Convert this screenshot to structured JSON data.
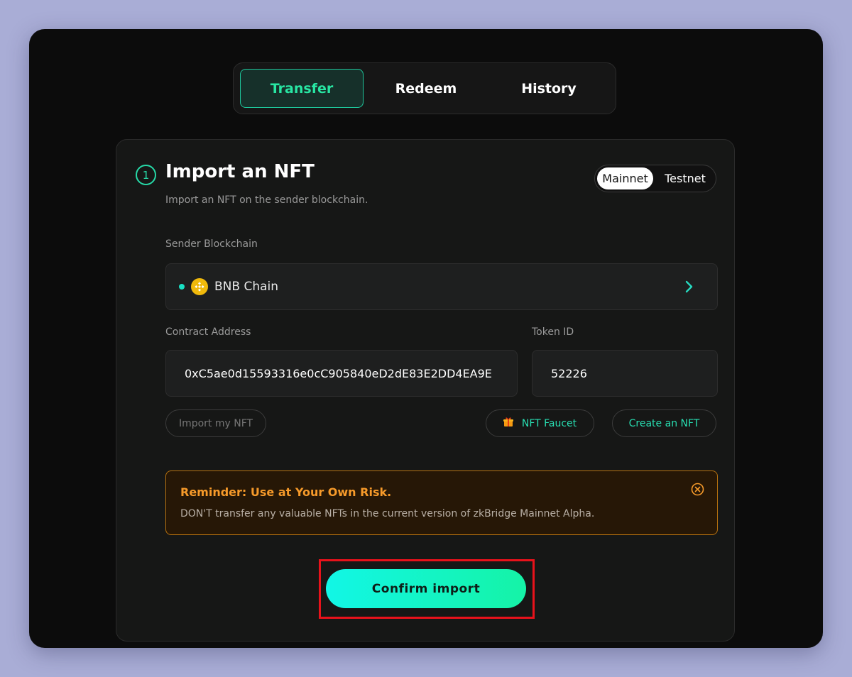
{
  "tabs": [
    {
      "label": "Transfer",
      "active": true
    },
    {
      "label": "Redeem",
      "active": false
    },
    {
      "label": "History",
      "active": false
    }
  ],
  "step": {
    "number": "1",
    "title": "Import an NFT",
    "subtitle": "Import an NFT on the sender blockchain."
  },
  "network": {
    "options": [
      "Mainnet",
      "Testnet"
    ],
    "selected": "Mainnet"
  },
  "sender": {
    "label": "Sender Blockchain",
    "chain_name": "BNB Chain",
    "chain_icon": "bnb-icon"
  },
  "contract": {
    "label": "Contract Address",
    "value": "0xC5ae0d15593316e0cC905840eD2dE83E2DD4EA9E"
  },
  "token": {
    "label": "Token ID",
    "value": "52226"
  },
  "buttons": {
    "import_my_nft": "Import my NFT",
    "nft_faucet": "NFT Faucet",
    "create_nft": "Create an NFT",
    "confirm": "Confirm import"
  },
  "reminder": {
    "title": "Reminder: Use at Your Own Risk.",
    "text": "DON'T transfer any valuable NFTs in the current version of zkBridge Mainnet Alpha."
  },
  "colors": {
    "accent": "#28e6a3",
    "warning": "#f69a2a",
    "highlight_box": "#e8121b"
  }
}
